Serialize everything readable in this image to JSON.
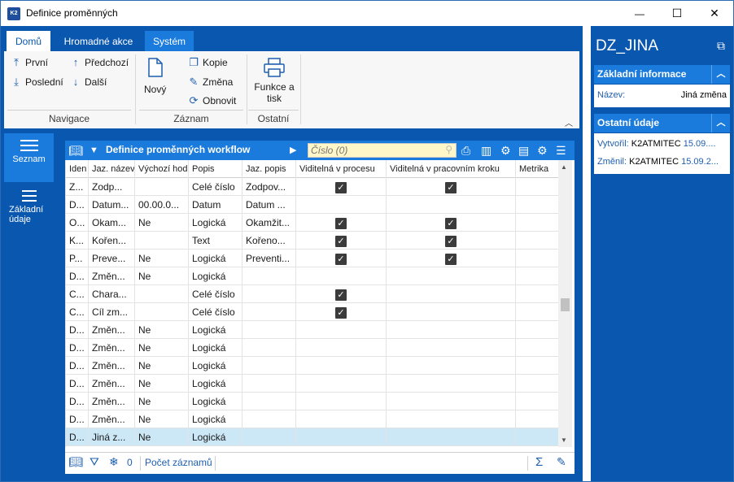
{
  "window": {
    "title": "Definice proměnných",
    "app_icon_text": "K2",
    "controls": {
      "minimize": "—",
      "maximize": "☐",
      "close": "✕"
    }
  },
  "ribbon": {
    "tabs": [
      "Domů",
      "Hromadné akce",
      "Systém"
    ],
    "active_tab": "Domů",
    "navigace": {
      "first": "První",
      "previous": "Předchozí",
      "last": "Poslední",
      "next": "Další",
      "label": "Navigace"
    },
    "zaznam": {
      "new": "Nový",
      "copy": "Kopie",
      "change": "Změna",
      "refresh": "Obnovit",
      "label": "Záznam"
    },
    "ostatni": {
      "print_line1": "Funkce a",
      "print_line2": "tisk",
      "label": "Ostatní"
    }
  },
  "leftnav": {
    "items": [
      {
        "label": "Seznam",
        "active": true
      },
      {
        "label_line1": "Základní",
        "label_line2": "údaje",
        "active": false
      }
    ]
  },
  "list": {
    "title": "Definice proměnných workflow",
    "search_placeholder": "Číslo (0)",
    "columns": [
      "Iden",
      "Jaz. název",
      "Výchozí hod",
      "Popis",
      "Jaz. popis",
      "Viditelná v procesu",
      "Viditelná v pracovním kroku",
      "Metrika"
    ],
    "rows": [
      {
        "id": "Z...",
        "name": "Zodp...",
        "default": "",
        "desc": "Celé číslo",
        "lang_desc": "Zodpov...",
        "vis_proc": true,
        "vis_step": true,
        "selected": false
      },
      {
        "id": "D...",
        "name": "Datum...",
        "default": "00.00.0...",
        "desc": "Datum",
        "lang_desc": "Datum ...",
        "vis_proc": false,
        "vis_step": false,
        "selected": false
      },
      {
        "id": "O...",
        "name": "Okam...",
        "default": "Ne",
        "desc": "Logická",
        "lang_desc": "Okamžit...",
        "vis_proc": true,
        "vis_step": true,
        "selected": false
      },
      {
        "id": "K...",
        "name": "Kořen...",
        "default": "",
        "desc": "Text",
        "lang_desc": "Kořeno...",
        "vis_proc": true,
        "vis_step": true,
        "selected": false
      },
      {
        "id": "P...",
        "name": "Preve...",
        "default": "Ne",
        "desc": "Logická",
        "lang_desc": "Preventi...",
        "vis_proc": true,
        "vis_step": true,
        "selected": false
      },
      {
        "id": "D...",
        "name": "Změn...",
        "default": "Ne",
        "desc": "Logická",
        "lang_desc": "",
        "vis_proc": false,
        "vis_step": false,
        "selected": false
      },
      {
        "id": "C...",
        "name": "Chara...",
        "default": "",
        "desc": "Celé číslo",
        "lang_desc": "",
        "vis_proc": true,
        "vis_step": false,
        "selected": false
      },
      {
        "id": "C...",
        "name": "Cíl zm...",
        "default": "",
        "desc": "Celé číslo",
        "lang_desc": "",
        "vis_proc": true,
        "vis_step": false,
        "selected": false
      },
      {
        "id": "D...",
        "name": "Změn...",
        "default": "Ne",
        "desc": "Logická",
        "lang_desc": "",
        "vis_proc": false,
        "vis_step": false,
        "selected": false
      },
      {
        "id": "D...",
        "name": "Změn...",
        "default": "Ne",
        "desc": "Logická",
        "lang_desc": "",
        "vis_proc": false,
        "vis_step": false,
        "selected": false
      },
      {
        "id": "D...",
        "name": "Změn...",
        "default": "Ne",
        "desc": "Logická",
        "lang_desc": "",
        "vis_proc": false,
        "vis_step": false,
        "selected": false
      },
      {
        "id": "D...",
        "name": "Změn...",
        "default": "Ne",
        "desc": "Logická",
        "lang_desc": "",
        "vis_proc": false,
        "vis_step": false,
        "selected": false
      },
      {
        "id": "D...",
        "name": "Změn...",
        "default": "Ne",
        "desc": "Logická",
        "lang_desc": "",
        "vis_proc": false,
        "vis_step": false,
        "selected": false
      },
      {
        "id": "D...",
        "name": "Změn...",
        "default": "Ne",
        "desc": "Logická",
        "lang_desc": "",
        "vis_proc": false,
        "vis_step": false,
        "selected": false
      },
      {
        "id": "D...",
        "name": "Jiná z...",
        "default": "Ne",
        "desc": "Logická",
        "lang_desc": "",
        "vis_proc": false,
        "vis_step": false,
        "selected": true
      }
    ],
    "status": {
      "filter_count": "0",
      "record_count_label": "Počet záznamů"
    }
  },
  "right_panel": {
    "title": "DZ_JINA",
    "basic": {
      "header": "Základní informace",
      "name_key": "Název:",
      "name_value": "Jiná změna"
    },
    "other": {
      "header": "Ostatní údaje",
      "created_key": "Vytvořil:",
      "created_user": "K2ATMITEC",
      "created_date": "15.09....",
      "changed_key": "Změnil:",
      "changed_user": "K2ATMITEC",
      "changed_date": "15.09.2..."
    }
  },
  "colors": {
    "frame_blue": "#0a57b0",
    "accent_blue": "#1a7bdc",
    "selected_row": "#cce8f7",
    "search_bg": "#fff7c8"
  }
}
